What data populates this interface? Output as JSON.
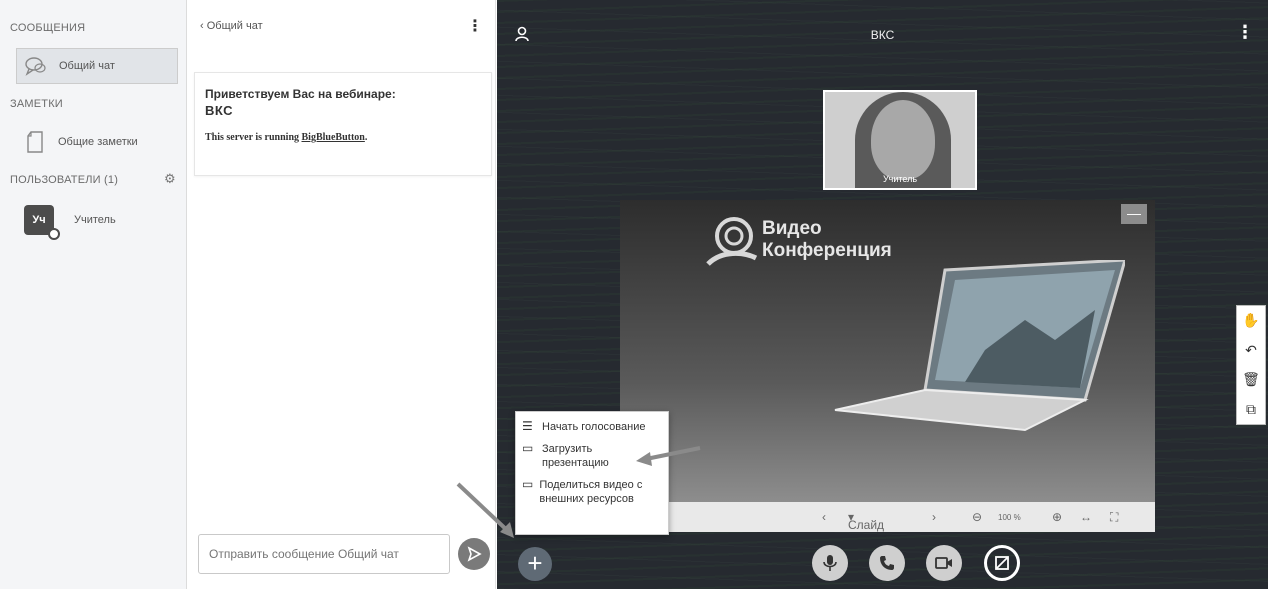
{
  "sidebar": {
    "messages_title": "СООБЩЕНИЯ",
    "public_chat": "Общий чат",
    "notes_title": "ЗАМЕТКИ",
    "shared_notes": "Общие заметки",
    "users_title": "ПОЛЬЗОВАТЕЛИ (1)",
    "user": {
      "initials": "Уч",
      "name": "Учитель"
    }
  },
  "chat": {
    "back_label": "Общий чат",
    "welcome_line1": "Приветствуем Вас на вебинаре:",
    "welcome_line2": "ВКС",
    "server_prefix": "This server is running ",
    "server_link": "BigBlueButton",
    "server_suffix": ".",
    "input_placeholder": "Отправить сообщение Общий чат"
  },
  "main": {
    "title": "ВКС",
    "webcam_label": "Учитель",
    "slide": {
      "logo_line1": "Видео",
      "logo_line2": "Конференция",
      "slide_label": "Слайд 1",
      "zoom": "100 %"
    },
    "actions_menu": [
      {
        "label": "Начать голосование",
        "icon": "list-icon"
      },
      {
        "label": "Загрузить презентацию",
        "icon": "presentation-icon"
      },
      {
        "label": "Поделиться видео с внешних ресурсов",
        "icon": "video-icon"
      }
    ]
  },
  "colors": {
    "main_bg": "#262a30",
    "sidebar_bg": "#f4f5f7",
    "accent": "#5f6a75"
  }
}
